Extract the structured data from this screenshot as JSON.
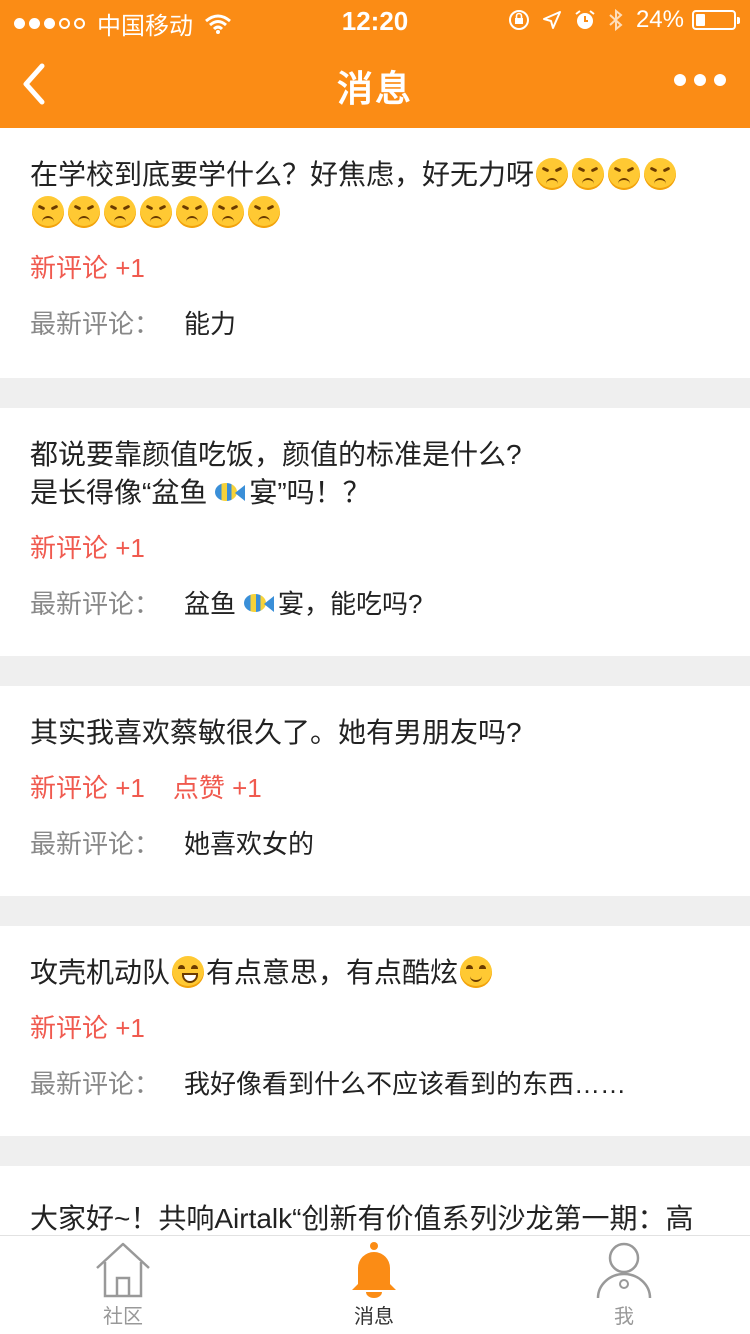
{
  "status_bar": {
    "carrier": "中国移动",
    "time": "12:20",
    "battery": "24%",
    "battery_level": 0.24
  },
  "nav": {
    "title": "消息"
  },
  "messages": [
    {
      "title_text_1": "在学校到底要学什么？好焦虑，好无力呀",
      "new_comment": "新评论 +1",
      "comment_label": "最新评论：",
      "comment": "能力"
    },
    {
      "title_line_1": "都说要靠颜值吃饭，颜值的标准是什么?",
      "title_line_2_a": "是长得像“盆鱼",
      "title_line_2_b": "宴”吗！？",
      "new_comment": "新评论 +1",
      "comment_label": "最新评论：",
      "comment_a": "盆鱼",
      "comment_b": "宴，能吃吗?"
    },
    {
      "title": "其实我喜欢蔡敏很久了。她有男朋友吗?",
      "new_comment": "新评论 +1",
      "like": "点赞 +1",
      "comment_label": "最新评论：",
      "comment": "她喜欢女的"
    },
    {
      "title_a": "攻壳机动队",
      "title_b": "有点意思，有点酷炫",
      "new_comment": "新评论 +1",
      "comment_label": "最新评论：",
      "comment": "我好像看到什么不应该看到的东西……"
    },
    {
      "title": "大家好~！共响Airtalk“创新有价值系列沙龙第一期：高"
    }
  ],
  "tabs": [
    {
      "label": "社区",
      "icon": "house-icon"
    },
    {
      "label": "消息",
      "icon": "bell-icon"
    },
    {
      "label": "我",
      "icon": "person-icon"
    }
  ],
  "colors": {
    "brand": "#fb8c15",
    "accent_red": "#f05a4f"
  }
}
